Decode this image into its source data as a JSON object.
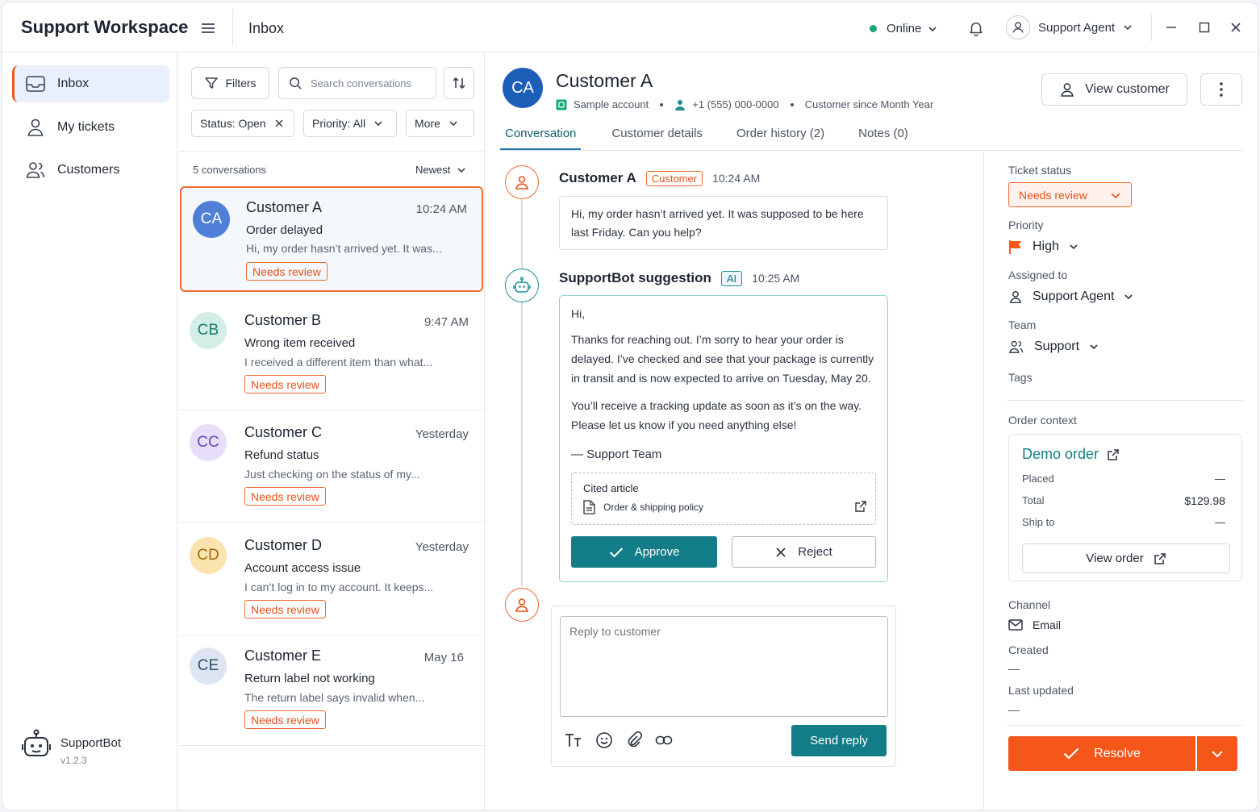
{
  "app": {
    "brand": "Support Workspace",
    "section": "Inbox"
  },
  "topbar": {
    "status": "Online",
    "agent": "Support Agent"
  },
  "nav": {
    "inbox": "Inbox",
    "my_tickets": "My tickets",
    "customers": "Customers"
  },
  "bot": {
    "name": "SupportBot",
    "version": "v1.2.3"
  },
  "list": {
    "filters_label": "Filters",
    "search_placeholder": "Search conversations",
    "chips": {
      "status": "Status: Open",
      "priority": "Priority: All",
      "more": "More"
    },
    "count": "5 conversations",
    "sort": "Newest",
    "conversations": [
      {
        "initials": "CA",
        "name": "Customer A",
        "time": "10:24 AM",
        "subject": "Order delayed",
        "preview": "Hi, my order hasn’t arrived yet. It was...",
        "badge": "Needs review"
      },
      {
        "initials": "CB",
        "name": "Customer B",
        "time": "9:47 AM",
        "subject": "Wrong item received",
        "preview": "I received a different item than what...",
        "badge": "Needs review"
      },
      {
        "initials": "CC",
        "name": "Customer C",
        "time": "Yesterday",
        "subject": "Refund status",
        "preview": "Just checking on the status of my...",
        "badge": "Needs review"
      },
      {
        "initials": "CD",
        "name": "Customer D",
        "time": "Yesterday",
        "subject": "Account access issue",
        "preview": "I can’t log in to my account. It keeps...",
        "badge": "Needs review"
      },
      {
        "initials": "CE",
        "name": "Customer E",
        "time": "May 16",
        "subject": "Return label not working",
        "preview": "The return label says invalid when...",
        "badge": "Needs review"
      }
    ]
  },
  "header": {
    "initials": "CA",
    "name": "Customer A",
    "account": "Sample account",
    "phone": "+1 (555) 000-0000",
    "since": "Customer since Month Year",
    "view_customer": "View customer"
  },
  "tabs": [
    "Conversation",
    "Customer details",
    "Order history (2)",
    "Notes (0)"
  ],
  "thread": {
    "customer_msg": {
      "who": "Customer A",
      "tag": "Customer",
      "time": "10:24 AM",
      "text": "Hi, my order hasn’t arrived yet. It was supposed to be here last Friday. Can you help?"
    },
    "ai_msg": {
      "who": "SupportBot suggestion",
      "tag": "AI",
      "time": "10:25 AM",
      "greeting": "Hi,",
      "p1": "Thanks for reaching out. I’m sorry to hear your order is delayed. I’ve checked and see that your package is currently in transit and is now expected to arrive on Tuesday, May 20.",
      "p2": "You’ll receive a tracking update as soon as it’s on the way. Please let us know if you need anything else!",
      "sign": "— Support Team",
      "cited_title": "Cited article",
      "cited_doc": "Order & shipping policy",
      "approve": "Approve",
      "reject": "Reject"
    }
  },
  "reply": {
    "placeholder": "Reply to customer",
    "send": "Send reply"
  },
  "details": {
    "ticket_status_label": "Ticket status",
    "ticket_status": "Needs review",
    "priority_label": "Priority",
    "priority": "High",
    "assigned_label": "Assigned to",
    "assigned": "Support Agent",
    "team_label": "Team",
    "team": "Support",
    "tags_label": "Tags",
    "order_context_label": "Order context",
    "order": {
      "title": "Demo order",
      "placed_label": "Placed",
      "placed": "—",
      "total_label": "Total",
      "total": "$129.98",
      "ship_label": "Ship to",
      "ship": "—",
      "view": "View order"
    },
    "channel_label": "Channel",
    "channel": "Email",
    "created_label": "Created",
    "created": "—",
    "updated_label": "Last updated",
    "updated": "—",
    "resolve": "Resolve"
  },
  "colors": {
    "accent": "#f5561a",
    "teal": "#137d87",
    "brand_blue": "#1d5fb8"
  }
}
